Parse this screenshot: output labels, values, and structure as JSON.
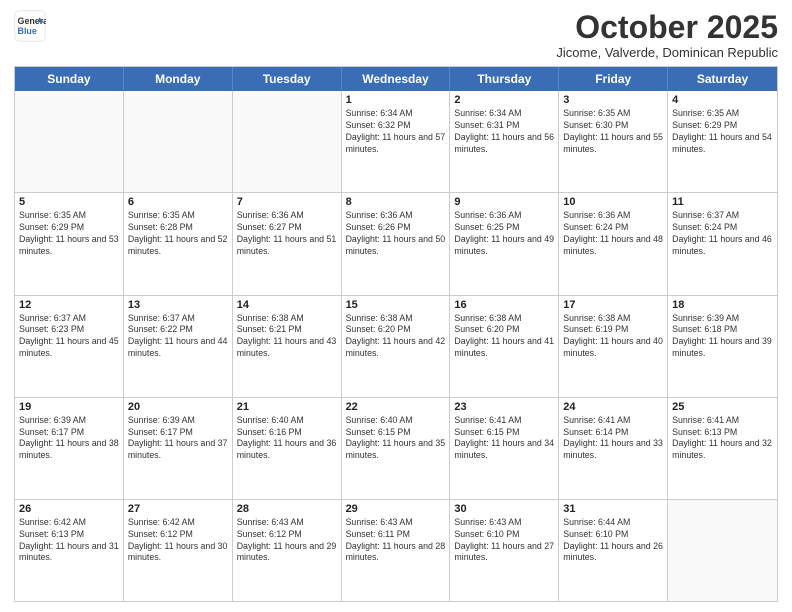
{
  "header": {
    "logo_general": "General",
    "logo_blue": "Blue",
    "month_title": "October 2025",
    "subtitle": "Jicome, Valverde, Dominican Republic"
  },
  "weekdays": [
    "Sunday",
    "Monday",
    "Tuesday",
    "Wednesday",
    "Thursday",
    "Friday",
    "Saturday"
  ],
  "rows": [
    [
      {
        "day": "",
        "info": ""
      },
      {
        "day": "",
        "info": ""
      },
      {
        "day": "",
        "info": ""
      },
      {
        "day": "1",
        "info": "Sunrise: 6:34 AM\nSunset: 6:32 PM\nDaylight: 11 hours and 57 minutes."
      },
      {
        "day": "2",
        "info": "Sunrise: 6:34 AM\nSunset: 6:31 PM\nDaylight: 11 hours and 56 minutes."
      },
      {
        "day": "3",
        "info": "Sunrise: 6:35 AM\nSunset: 6:30 PM\nDaylight: 11 hours and 55 minutes."
      },
      {
        "day": "4",
        "info": "Sunrise: 6:35 AM\nSunset: 6:29 PM\nDaylight: 11 hours and 54 minutes."
      }
    ],
    [
      {
        "day": "5",
        "info": "Sunrise: 6:35 AM\nSunset: 6:29 PM\nDaylight: 11 hours and 53 minutes."
      },
      {
        "day": "6",
        "info": "Sunrise: 6:35 AM\nSunset: 6:28 PM\nDaylight: 11 hours and 52 minutes."
      },
      {
        "day": "7",
        "info": "Sunrise: 6:36 AM\nSunset: 6:27 PM\nDaylight: 11 hours and 51 minutes."
      },
      {
        "day": "8",
        "info": "Sunrise: 6:36 AM\nSunset: 6:26 PM\nDaylight: 11 hours and 50 minutes."
      },
      {
        "day": "9",
        "info": "Sunrise: 6:36 AM\nSunset: 6:25 PM\nDaylight: 11 hours and 49 minutes."
      },
      {
        "day": "10",
        "info": "Sunrise: 6:36 AM\nSunset: 6:24 PM\nDaylight: 11 hours and 48 minutes."
      },
      {
        "day": "11",
        "info": "Sunrise: 6:37 AM\nSunset: 6:24 PM\nDaylight: 11 hours and 46 minutes."
      }
    ],
    [
      {
        "day": "12",
        "info": "Sunrise: 6:37 AM\nSunset: 6:23 PM\nDaylight: 11 hours and 45 minutes."
      },
      {
        "day": "13",
        "info": "Sunrise: 6:37 AM\nSunset: 6:22 PM\nDaylight: 11 hours and 44 minutes."
      },
      {
        "day": "14",
        "info": "Sunrise: 6:38 AM\nSunset: 6:21 PM\nDaylight: 11 hours and 43 minutes."
      },
      {
        "day": "15",
        "info": "Sunrise: 6:38 AM\nSunset: 6:20 PM\nDaylight: 11 hours and 42 minutes."
      },
      {
        "day": "16",
        "info": "Sunrise: 6:38 AM\nSunset: 6:20 PM\nDaylight: 11 hours and 41 minutes."
      },
      {
        "day": "17",
        "info": "Sunrise: 6:38 AM\nSunset: 6:19 PM\nDaylight: 11 hours and 40 minutes."
      },
      {
        "day": "18",
        "info": "Sunrise: 6:39 AM\nSunset: 6:18 PM\nDaylight: 11 hours and 39 minutes."
      }
    ],
    [
      {
        "day": "19",
        "info": "Sunrise: 6:39 AM\nSunset: 6:17 PM\nDaylight: 11 hours and 38 minutes."
      },
      {
        "day": "20",
        "info": "Sunrise: 6:39 AM\nSunset: 6:17 PM\nDaylight: 11 hours and 37 minutes."
      },
      {
        "day": "21",
        "info": "Sunrise: 6:40 AM\nSunset: 6:16 PM\nDaylight: 11 hours and 36 minutes."
      },
      {
        "day": "22",
        "info": "Sunrise: 6:40 AM\nSunset: 6:15 PM\nDaylight: 11 hours and 35 minutes."
      },
      {
        "day": "23",
        "info": "Sunrise: 6:41 AM\nSunset: 6:15 PM\nDaylight: 11 hours and 34 minutes."
      },
      {
        "day": "24",
        "info": "Sunrise: 6:41 AM\nSunset: 6:14 PM\nDaylight: 11 hours and 33 minutes."
      },
      {
        "day": "25",
        "info": "Sunrise: 6:41 AM\nSunset: 6:13 PM\nDaylight: 11 hours and 32 minutes."
      }
    ],
    [
      {
        "day": "26",
        "info": "Sunrise: 6:42 AM\nSunset: 6:13 PM\nDaylight: 11 hours and 31 minutes."
      },
      {
        "day": "27",
        "info": "Sunrise: 6:42 AM\nSunset: 6:12 PM\nDaylight: 11 hours and 30 minutes."
      },
      {
        "day": "28",
        "info": "Sunrise: 6:43 AM\nSunset: 6:12 PM\nDaylight: 11 hours and 29 minutes."
      },
      {
        "day": "29",
        "info": "Sunrise: 6:43 AM\nSunset: 6:11 PM\nDaylight: 11 hours and 28 minutes."
      },
      {
        "day": "30",
        "info": "Sunrise: 6:43 AM\nSunset: 6:10 PM\nDaylight: 11 hours and 27 minutes."
      },
      {
        "day": "31",
        "info": "Sunrise: 6:44 AM\nSunset: 6:10 PM\nDaylight: 11 hours and 26 minutes."
      },
      {
        "day": "",
        "info": ""
      }
    ]
  ]
}
